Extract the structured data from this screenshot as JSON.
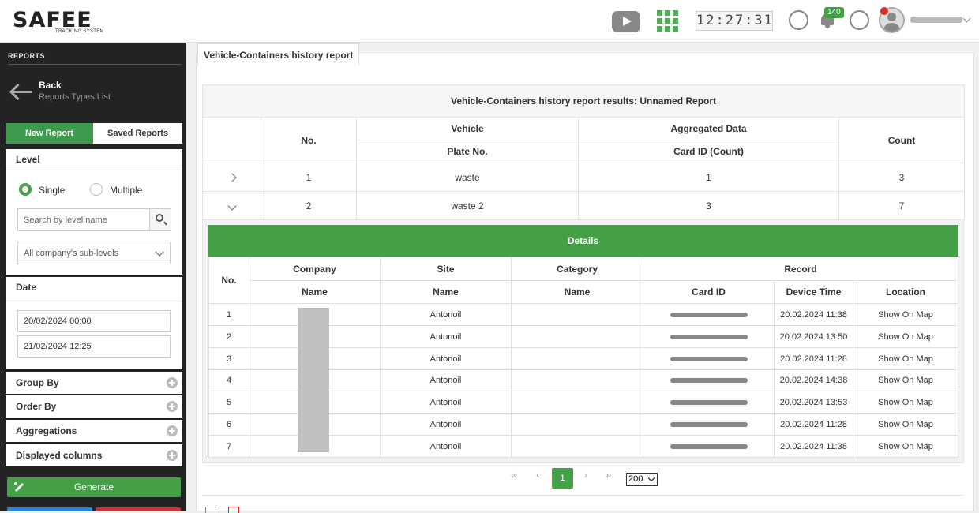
{
  "header": {
    "logo_text": "SAFEE",
    "logo_sub": "TRACKING SYSTEM",
    "clock": "12:27:31",
    "notifications_count": "140"
  },
  "sidebar": {
    "title": "REPORTS",
    "back_label": "Back",
    "back_sub": "Reports Types List",
    "tabs": {
      "new": "New Report",
      "saved": "Saved Reports"
    },
    "level": {
      "title": "Level",
      "single": "Single",
      "multiple": "Multiple",
      "search_placeholder": "Search by level name",
      "sublevels": "All company's sub-levels"
    },
    "date": {
      "title": "Date",
      "from": "20/02/2024 00:00",
      "to": "21/02/2024 12:25"
    },
    "accordions": [
      "Group By",
      "Order By",
      "Aggregations",
      "Displayed columns"
    ],
    "generate": "Generate"
  },
  "report": {
    "tab": "Vehicle-Containers history report",
    "results_title": "Vehicle-Containers history report results: Unnamed Report",
    "headers": {
      "no": "No.",
      "vehicle": "Vehicle",
      "plate": "Plate No.",
      "agg": "Aggregated Data",
      "card": "Card ID (Count)",
      "count": "Count"
    },
    "rows": [
      {
        "no": "1",
        "plate": "waste",
        "card": "1",
        "count": "3"
      },
      {
        "no": "2",
        "plate": "waste 2",
        "card": "3",
        "count": "7"
      }
    ],
    "details": {
      "title": "Details",
      "headers": {
        "no": "No.",
        "company": "Company",
        "site": "Site",
        "category": "Category",
        "record": "Record",
        "name": "Name",
        "card": "Card ID",
        "time": "Device Time",
        "location": "Location"
      },
      "rows": [
        {
          "no": "1",
          "site": "Antonoil",
          "time": "20.02.2024 11:38",
          "link": "Show On Map"
        },
        {
          "no": "2",
          "site": "Antonoil",
          "time": "20.02.2024 13:50",
          "link": "Show On Map"
        },
        {
          "no": "3",
          "site": "Antonoil",
          "time": "20.02.2024 11:28",
          "link": "Show On Map"
        },
        {
          "no": "4",
          "site": "Antonoil",
          "time": "20.02.2024 14:38",
          "link": "Show On Map"
        },
        {
          "no": "5",
          "site": "Antonoil",
          "time": "20.02.2024 13:53",
          "link": "Show On Map"
        },
        {
          "no": "6",
          "site": "Antonoil",
          "time": "20.02.2024 11:28",
          "link": "Show On Map"
        },
        {
          "no": "7",
          "site": "Antonoil",
          "time": "20.02.2024 11:38",
          "link": "Show On Map"
        }
      ]
    },
    "pager": {
      "first": "«",
      "prev": "‹",
      "page": "1",
      "next": "›",
      "last": "»",
      "size": "200"
    }
  }
}
